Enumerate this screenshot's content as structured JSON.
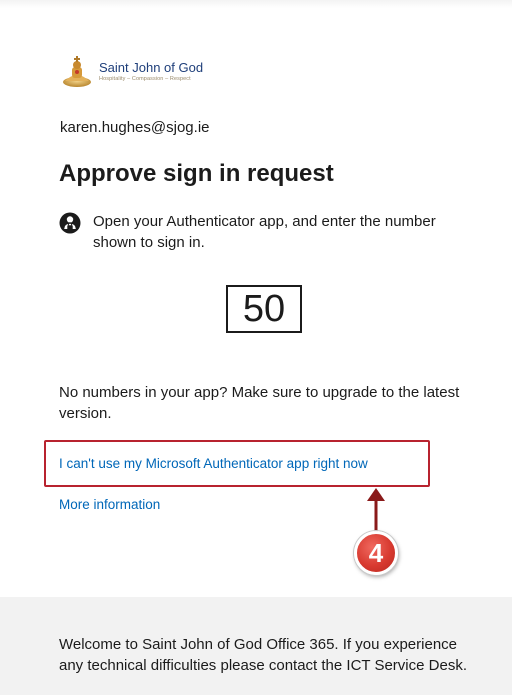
{
  "brand": {
    "name": "Saint John of God",
    "tagline": "Hospitality – Compassion – Respect",
    "name_color": "#1f3f7a",
    "logo_icon": "sjog-logo-icon"
  },
  "identity": {
    "email": "karen.hughes@sjog.ie"
  },
  "main": {
    "title": "Approve sign in request",
    "instruction": "Open your Authenticator app, and enter the number shown to sign in.",
    "instruction_icon": "lock-person-icon",
    "number": "50",
    "upgrade_note": "No numbers in your app? Make sure to upgrade to the latest version."
  },
  "links": {
    "cant_use": "I can't use my Microsoft Authenticator app right now",
    "more_info": "More information",
    "link_color": "#0067b8"
  },
  "annotation": {
    "step_number": "4",
    "highlight_color": "#b8232f"
  },
  "footer": {
    "text": "Welcome to Saint John of God Office 365. If you experience any technical difficulties please contact the ICT Service Desk."
  }
}
